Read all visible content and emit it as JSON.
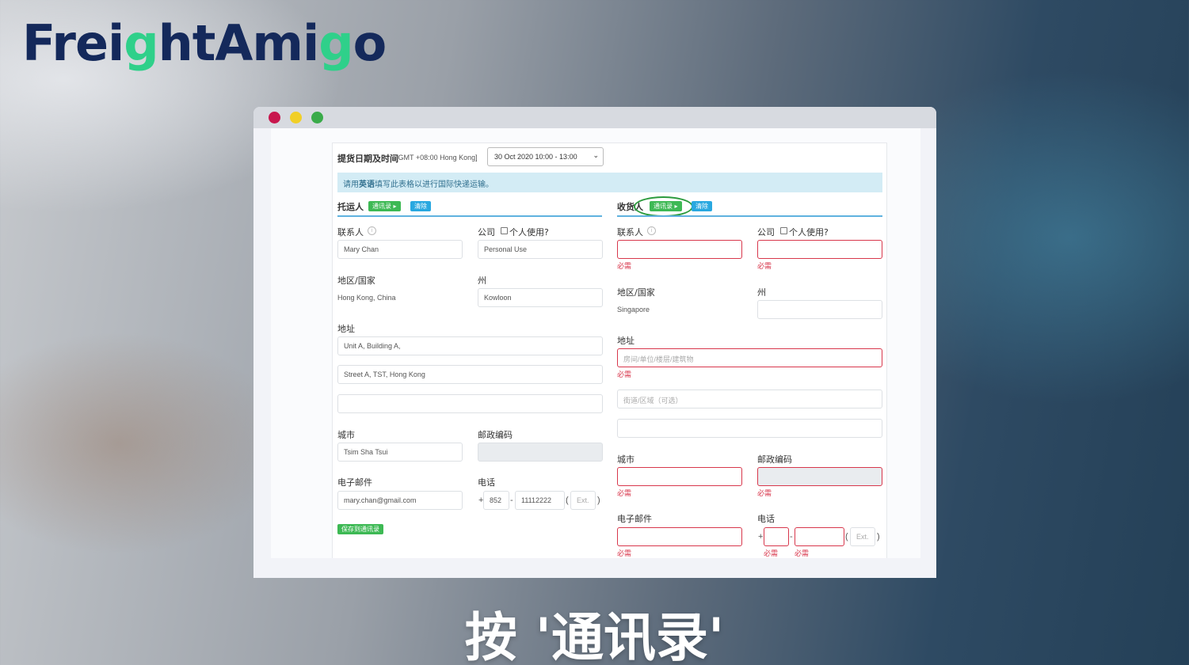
{
  "brand": {
    "parts": [
      "Frei",
      "g",
      "htAmi",
      "g",
      "o"
    ]
  },
  "caption": "按 '通讯录'",
  "form": {
    "pickup_label": "提货日期及时间",
    "timezone": "[GMT +08:00 Hong Kong]",
    "pickup_value": "30 Oct 2020 10:00 - 13:00",
    "notice_pre": "请用",
    "notice_bold": "英语",
    "notice_post": "填写此表格以进行国际快递运输。",
    "address_book_label": "通讯录 ▸",
    "clear_label": "清除",
    "required": "必需",
    "labels": {
      "contact": "联系人",
      "company": "公司",
      "personal_use": "个人使用?",
      "country": "地区/国家",
      "state": "州",
      "address": "地址",
      "city": "城市",
      "postal": "邮政编码",
      "email": "电子邮件",
      "phone": "电话",
      "plus": "+",
      "dash": "-",
      "open_paren": "(",
      "close_paren": ")"
    },
    "shipper": {
      "title": "托运人",
      "contact": "Mary Chan",
      "company": "Personal Use",
      "country": "Hong Kong, China",
      "state": "Kowloon",
      "address1": "Unit A, Building A,",
      "address2": "Street A, TST, Hong Kong",
      "address3": "",
      "city": "Tsim Sha Tsui",
      "postal": "",
      "email": "mary.chan@gmail.com",
      "phone_cc": "852",
      "phone_num": "11112222",
      "phone_ext_placeholder": "Ext.",
      "save_label": "保存到通讯录"
    },
    "consignee": {
      "title": "收货人",
      "contact": "",
      "company": "",
      "country": "Singapore",
      "state": "",
      "address1_placeholder": "房间/单位/楼层/建筑物",
      "address2_placeholder": "街道/区域（可选）",
      "address3": "",
      "city": "",
      "postal": "",
      "email": "",
      "phone_cc": "",
      "phone_num": "",
      "phone_ext_placeholder": "Ext."
    }
  }
}
